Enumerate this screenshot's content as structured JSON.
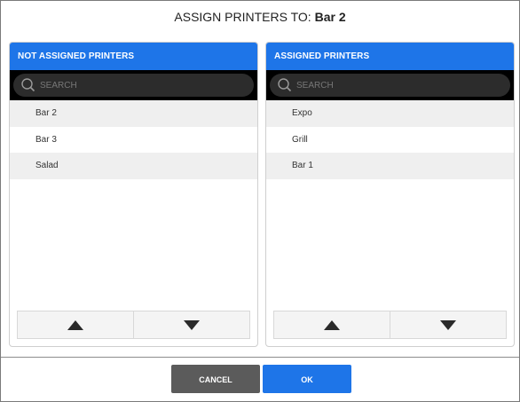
{
  "dialog": {
    "title_prefix": "ASSIGN PRINTERS TO: ",
    "title_target": "Bar 2"
  },
  "left_panel": {
    "header": "NOT ASSIGNED PRINTERS",
    "search_placeholder": "SEARCH",
    "items": [
      "Bar 2",
      "Bar 3",
      "Salad"
    ]
  },
  "right_panel": {
    "header": "ASSIGNED PRINTERS",
    "search_placeholder": "SEARCH",
    "items": [
      "Expo",
      "Grill",
      "Bar 1"
    ]
  },
  "buttons": {
    "cancel": "CANCEL",
    "ok": "OK"
  },
  "icons": {
    "search": "search-icon",
    "move_up": "triangle-up-icon",
    "move_down": "triangle-down-icon"
  },
  "colors": {
    "accent": "#1e75e8",
    "cancel": "#5b5b5b",
    "search_bar": "#000000"
  }
}
